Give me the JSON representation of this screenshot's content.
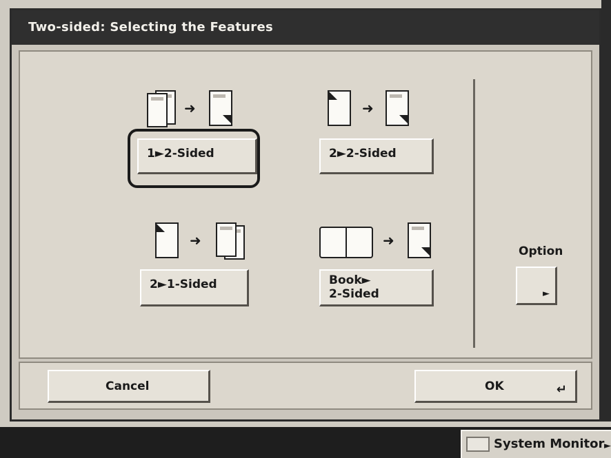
{
  "dialog": {
    "title": "Two-sided: Selecting the Features",
    "modes": {
      "one_to_two": "1►2-Sided",
      "two_to_two": "2►2-Sided",
      "two_to_one": "2►1-Sided",
      "book_to_two": "Book►\n2-Sided"
    },
    "selected_mode": "1►2-Sided",
    "option_label": "Option",
    "cancel_label": "Cancel",
    "ok_label": "OK"
  },
  "taskbar": {
    "system_monitor_label": "System Monitor"
  },
  "icons": {
    "arrow": "➜",
    "option_arrow": "►",
    "ok_return": "↵"
  }
}
